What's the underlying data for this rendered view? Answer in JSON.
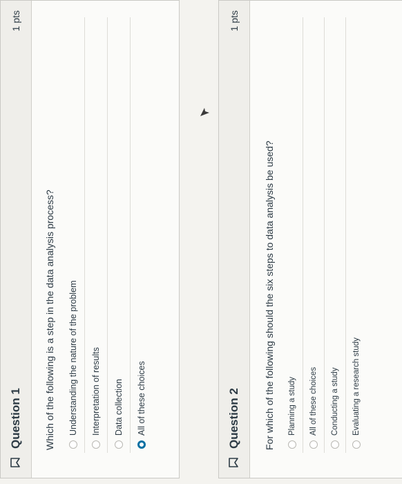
{
  "questions": [
    {
      "title": "Question 1",
      "points": "1 pts",
      "prompt": "Which of the following is a step in the data analysis process?",
      "choices": [
        {
          "label": "Understanding the nature of the problem",
          "selected": false
        },
        {
          "label": "Interpretation of results",
          "selected": false
        },
        {
          "label": "Data collection",
          "selected": false
        },
        {
          "label": "All of these choices",
          "selected": true
        }
      ]
    },
    {
      "title": "Question 2",
      "points": "1 pts",
      "prompt": "For which of the following should the six steps to data analysis be used?",
      "choices": [
        {
          "label": "Planning a study",
          "selected": false
        },
        {
          "label": "All of these choices",
          "selected": false
        },
        {
          "label": "Conducting a study",
          "selected": false
        },
        {
          "label": "Evaluating a research study",
          "selected": false
        }
      ]
    }
  ],
  "colors": {
    "accent": "#0770a3",
    "text": "#2d3b45",
    "header_bg": "#efeeea"
  },
  "icons": {
    "flag": "flag-icon",
    "cursor": "cursor-icon"
  }
}
